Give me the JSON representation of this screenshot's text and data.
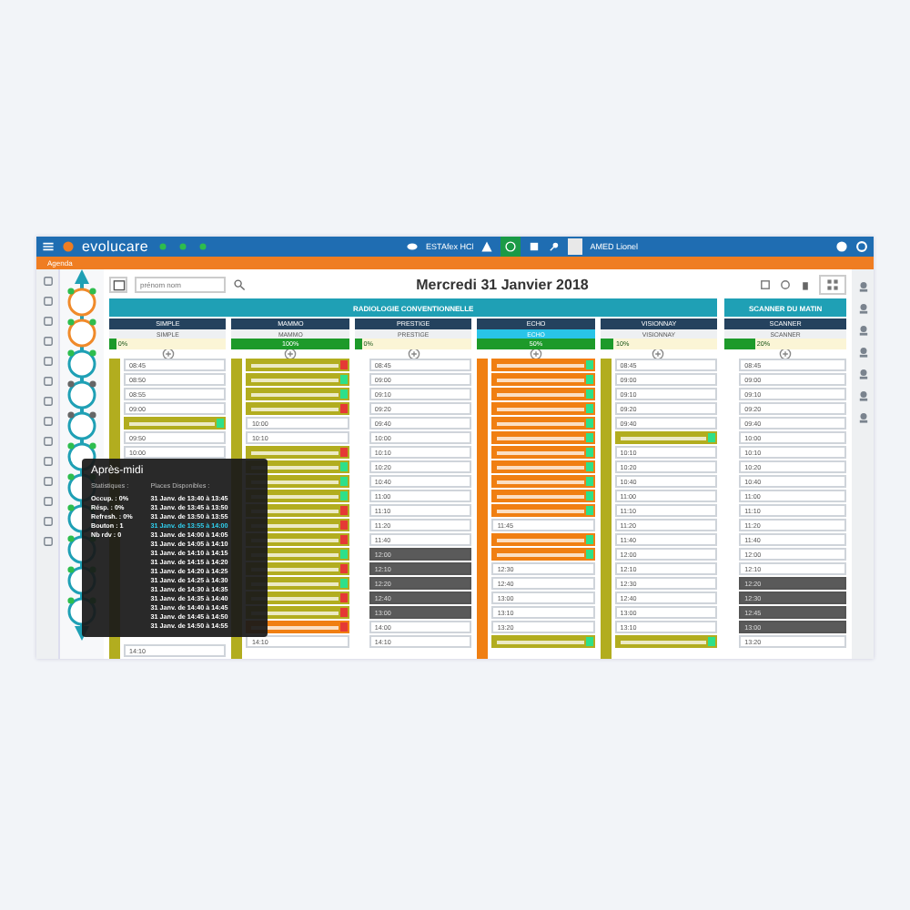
{
  "top_bar": {
    "logo": "evolucare",
    "status": "ESTAfex HCl",
    "user": "AMED Lionel"
  },
  "module_bar": {
    "title": "Agenda"
  },
  "toolbar": {
    "search_placeholder": "prénom nom",
    "date_title": "Mercredi 31 Janvier 2018"
  },
  "groups": [
    {
      "title": "RADIOLOGIE CONVENTIONNELLE",
      "columns": [
        {
          "name": "SIMPLE",
          "sub": "SIMPLE",
          "highlight": false,
          "level": 0.06,
          "level_text": "0%",
          "lane": {
            "color": "#b2ad1f"
          },
          "slots": [
            {
              "kind": "free",
              "time": "08:45"
            },
            {
              "kind": "free",
              "time": "08:50"
            },
            {
              "kind": "free",
              "time": "08:55"
            },
            {
              "kind": "free",
              "time": "09:00"
            },
            {
              "kind": "event",
              "color": "#b2ad1f",
              "alert": false
            },
            {
              "kind": "free",
              "time": "09:50"
            },
            {
              "kind": "free",
              "time": "10:00"
            }
          ],
          "bottom_slots": [
            {
              "kind": "free",
              "time": "14:10"
            }
          ]
        },
        {
          "name": "MAMMO",
          "sub": "MAMMO",
          "highlight": false,
          "level": 1,
          "level_text": "100%",
          "lane": {
            "color": "#b2ad1f"
          },
          "slots": [
            {
              "kind": "event",
              "color": "#b2ad1f",
              "alert": true
            },
            {
              "kind": "event",
              "color": "#b2ad1f",
              "alert": false
            },
            {
              "kind": "event",
              "color": "#b2ad1f",
              "alert": false
            },
            {
              "kind": "event",
              "color": "#b2ad1f",
              "alert": true
            },
            {
              "kind": "free",
              "time": "10:00"
            },
            {
              "kind": "free",
              "time": "10:10"
            },
            {
              "kind": "event",
              "color": "#b2ad1f",
              "alert": true
            },
            {
              "kind": "event",
              "color": "#b2ad1f",
              "alert": false
            },
            {
              "kind": "event",
              "color": "#b2ad1f",
              "alert": false
            },
            {
              "kind": "event",
              "color": "#b2ad1f",
              "alert": false
            },
            {
              "kind": "event",
              "color": "#b2ad1f",
              "alert": true
            },
            {
              "kind": "event",
              "color": "#b2ad1f",
              "alert": true
            },
            {
              "kind": "event",
              "color": "#b2ad1f",
              "alert": true
            },
            {
              "kind": "event",
              "color": "#b2ad1f",
              "alert": false
            },
            {
              "kind": "event",
              "color": "#b2ad1f",
              "alert": true
            },
            {
              "kind": "event",
              "color": "#b2ad1f",
              "alert": false
            },
            {
              "kind": "event",
              "color": "#b2ad1f",
              "alert": true
            },
            {
              "kind": "event",
              "color": "#b2ad1f",
              "alert": true
            },
            {
              "kind": "event",
              "color": "#f07f12",
              "alert": true
            },
            {
              "kind": "free",
              "time": "14:10"
            }
          ]
        },
        {
          "name": "PRESTIGE",
          "sub": "PRESTIGE",
          "highlight": false,
          "level": 0.06,
          "level_text": "0%",
          "slots": [
            {
              "kind": "free",
              "time": "08:45"
            },
            {
              "kind": "free",
              "time": "09:00"
            },
            {
              "kind": "free",
              "time": "09:10"
            },
            {
              "kind": "free",
              "time": "09:20"
            },
            {
              "kind": "free",
              "time": "09:40"
            },
            {
              "kind": "free",
              "time": "10:00"
            },
            {
              "kind": "free",
              "time": "10:10"
            },
            {
              "kind": "free",
              "time": "10:20"
            },
            {
              "kind": "free",
              "time": "10:40"
            },
            {
              "kind": "free",
              "time": "11:00"
            },
            {
              "kind": "free",
              "time": "11:10"
            },
            {
              "kind": "free",
              "time": "11:20"
            },
            {
              "kind": "free",
              "time": "11:40"
            },
            {
              "kind": "blocked",
              "time": "12:00"
            },
            {
              "kind": "blocked",
              "time": "12:10"
            },
            {
              "kind": "blocked",
              "time": "12:20"
            },
            {
              "kind": "blocked",
              "time": "12:40"
            },
            {
              "kind": "blocked",
              "time": "13:00"
            },
            {
              "kind": "free",
              "time": "14:00"
            },
            {
              "kind": "free",
              "time": "14:10"
            }
          ]
        },
        {
          "name": "ECHO",
          "sub": "ECHO",
          "highlight": true,
          "level": 1,
          "level_text": "50%",
          "lane": {
            "color": "#f07f12"
          },
          "slots": [
            {
              "kind": "event",
              "color": "#f07f12",
              "alert": false
            },
            {
              "kind": "event",
              "color": "#f07f12",
              "alert": false
            },
            {
              "kind": "event",
              "color": "#f07f12",
              "alert": false
            },
            {
              "kind": "event",
              "color": "#f07f12",
              "alert": false
            },
            {
              "kind": "event",
              "color": "#f07f12",
              "alert": false
            },
            {
              "kind": "event",
              "color": "#f07f12",
              "alert": false
            },
            {
              "kind": "event",
              "color": "#f07f12",
              "alert": false
            },
            {
              "kind": "event",
              "color": "#f07f12",
              "alert": false
            },
            {
              "kind": "event",
              "color": "#f07f12",
              "alert": false
            },
            {
              "kind": "event",
              "color": "#f07f12",
              "alert": false
            },
            {
              "kind": "event",
              "color": "#f07f12",
              "alert": false
            },
            {
              "kind": "free",
              "time": "11:45"
            },
            {
              "kind": "event",
              "color": "#f07f12",
              "alert": false
            },
            {
              "kind": "event",
              "color": "#f07f12",
              "alert": false
            },
            {
              "kind": "free",
              "time": "12:30"
            },
            {
              "kind": "free",
              "time": "12:40"
            },
            {
              "kind": "free",
              "time": "13:00"
            },
            {
              "kind": "free",
              "time": "13:10"
            },
            {
              "kind": "free",
              "time": "13:20"
            },
            {
              "kind": "event",
              "color": "#b2ad1f",
              "alert": false
            }
          ]
        },
        {
          "name": "VISIONNAY",
          "sub": "VISIONNAY",
          "highlight": false,
          "level": 0.12,
          "level_text": "10%",
          "lane": {
            "color": "#b2ad1f"
          },
          "slots": [
            {
              "kind": "free",
              "time": "08:45"
            },
            {
              "kind": "free",
              "time": "09:00"
            },
            {
              "kind": "free",
              "time": "09:10"
            },
            {
              "kind": "free",
              "time": "09:20"
            },
            {
              "kind": "free",
              "time": "09:40"
            },
            {
              "kind": "event",
              "color": "#b2ad1f",
              "alert": false
            },
            {
              "kind": "free",
              "time": "10:10"
            },
            {
              "kind": "free",
              "time": "10:20"
            },
            {
              "kind": "free",
              "time": "10:40"
            },
            {
              "kind": "free",
              "time": "11:00"
            },
            {
              "kind": "free",
              "time": "11:10"
            },
            {
              "kind": "free",
              "time": "11:20"
            },
            {
              "kind": "free",
              "time": "11:40"
            },
            {
              "kind": "free",
              "time": "12:00"
            },
            {
              "kind": "free",
              "time": "12:10"
            },
            {
              "kind": "free",
              "time": "12:30"
            },
            {
              "kind": "free",
              "time": "12:40"
            },
            {
              "kind": "free",
              "time": "13:00"
            },
            {
              "kind": "free",
              "time": "13:10"
            },
            {
              "kind": "event",
              "color": "#b2ad1f",
              "alert": false
            }
          ]
        }
      ]
    },
    {
      "title": "SCANNER DU MATIN",
      "columns": [
        {
          "name": "SCANNER",
          "sub": "SCANNER",
          "highlight": false,
          "level": 0.25,
          "level_text": "20%",
          "slots": [
            {
              "kind": "free",
              "time": "08:45"
            },
            {
              "kind": "free",
              "time": "09:00"
            },
            {
              "kind": "free",
              "time": "09:10"
            },
            {
              "kind": "free",
              "time": "09:20"
            },
            {
              "kind": "free",
              "time": "09:40"
            },
            {
              "kind": "free",
              "time": "10:00"
            },
            {
              "kind": "free",
              "time": "10:10"
            },
            {
              "kind": "free",
              "time": "10:20"
            },
            {
              "kind": "free",
              "time": "10:40"
            },
            {
              "kind": "free",
              "time": "11:00"
            },
            {
              "kind": "free",
              "time": "11:10"
            },
            {
              "kind": "free",
              "time": "11:20"
            },
            {
              "kind": "free",
              "time": "11:40"
            },
            {
              "kind": "free",
              "time": "12:00"
            },
            {
              "kind": "free",
              "time": "12:10"
            },
            {
              "kind": "blocked",
              "time": "12:20"
            },
            {
              "kind": "blocked",
              "time": "12:30"
            },
            {
              "kind": "blocked",
              "time": "12:45"
            },
            {
              "kind": "blocked",
              "time": "13:00"
            },
            {
              "kind": "free",
              "time": "13:20"
            }
          ]
        }
      ]
    }
  ],
  "tooltip": {
    "title": "Après-midi",
    "stats_heading": "Statistiques :",
    "stats": [
      "Occup. : 0%",
      "Résp. : 0%",
      "Refresh. : 0%",
      "Bouton : 1",
      "Nb rdv : 0"
    ],
    "slots_heading": "Places Disponibles :",
    "slots": [
      {
        "text": "31 Janv. de 13:40 à 13:45",
        "selected": false
      },
      {
        "text": "31 Janv. de 13:45 à 13:50",
        "selected": false
      },
      {
        "text": "31 Janv. de 13:50 à 13:55",
        "selected": false
      },
      {
        "text": "31 Janv. de 13:55 à 14:00",
        "selected": true
      },
      {
        "text": "31 Janv. de 14:00 à 14:05",
        "selected": false
      },
      {
        "text": "31 Janv. de 14:05 à 14:10",
        "selected": false
      },
      {
        "text": "31 Janv. de 14:10 à 14:15",
        "selected": false
      },
      {
        "text": "31 Janv. de 14:15 à 14:20",
        "selected": false
      },
      {
        "text": "31 Janv. de 14:20 à 14:25",
        "selected": false
      },
      {
        "text": "31 Janv. de 14:25 à 14:30",
        "selected": false
      },
      {
        "text": "31 Janv. de 14:30 à 14:35",
        "selected": false
      },
      {
        "text": "31 Janv. de 14:35 à 14:40",
        "selected": false
      },
      {
        "text": "31 Janv. de 14:40 à 14:45",
        "selected": false
      },
      {
        "text": "31 Janv. de 14:45 à 14:50",
        "selected": false
      },
      {
        "text": "31 Janv. de 14:50 à 14:55",
        "selected": false
      }
    ]
  }
}
